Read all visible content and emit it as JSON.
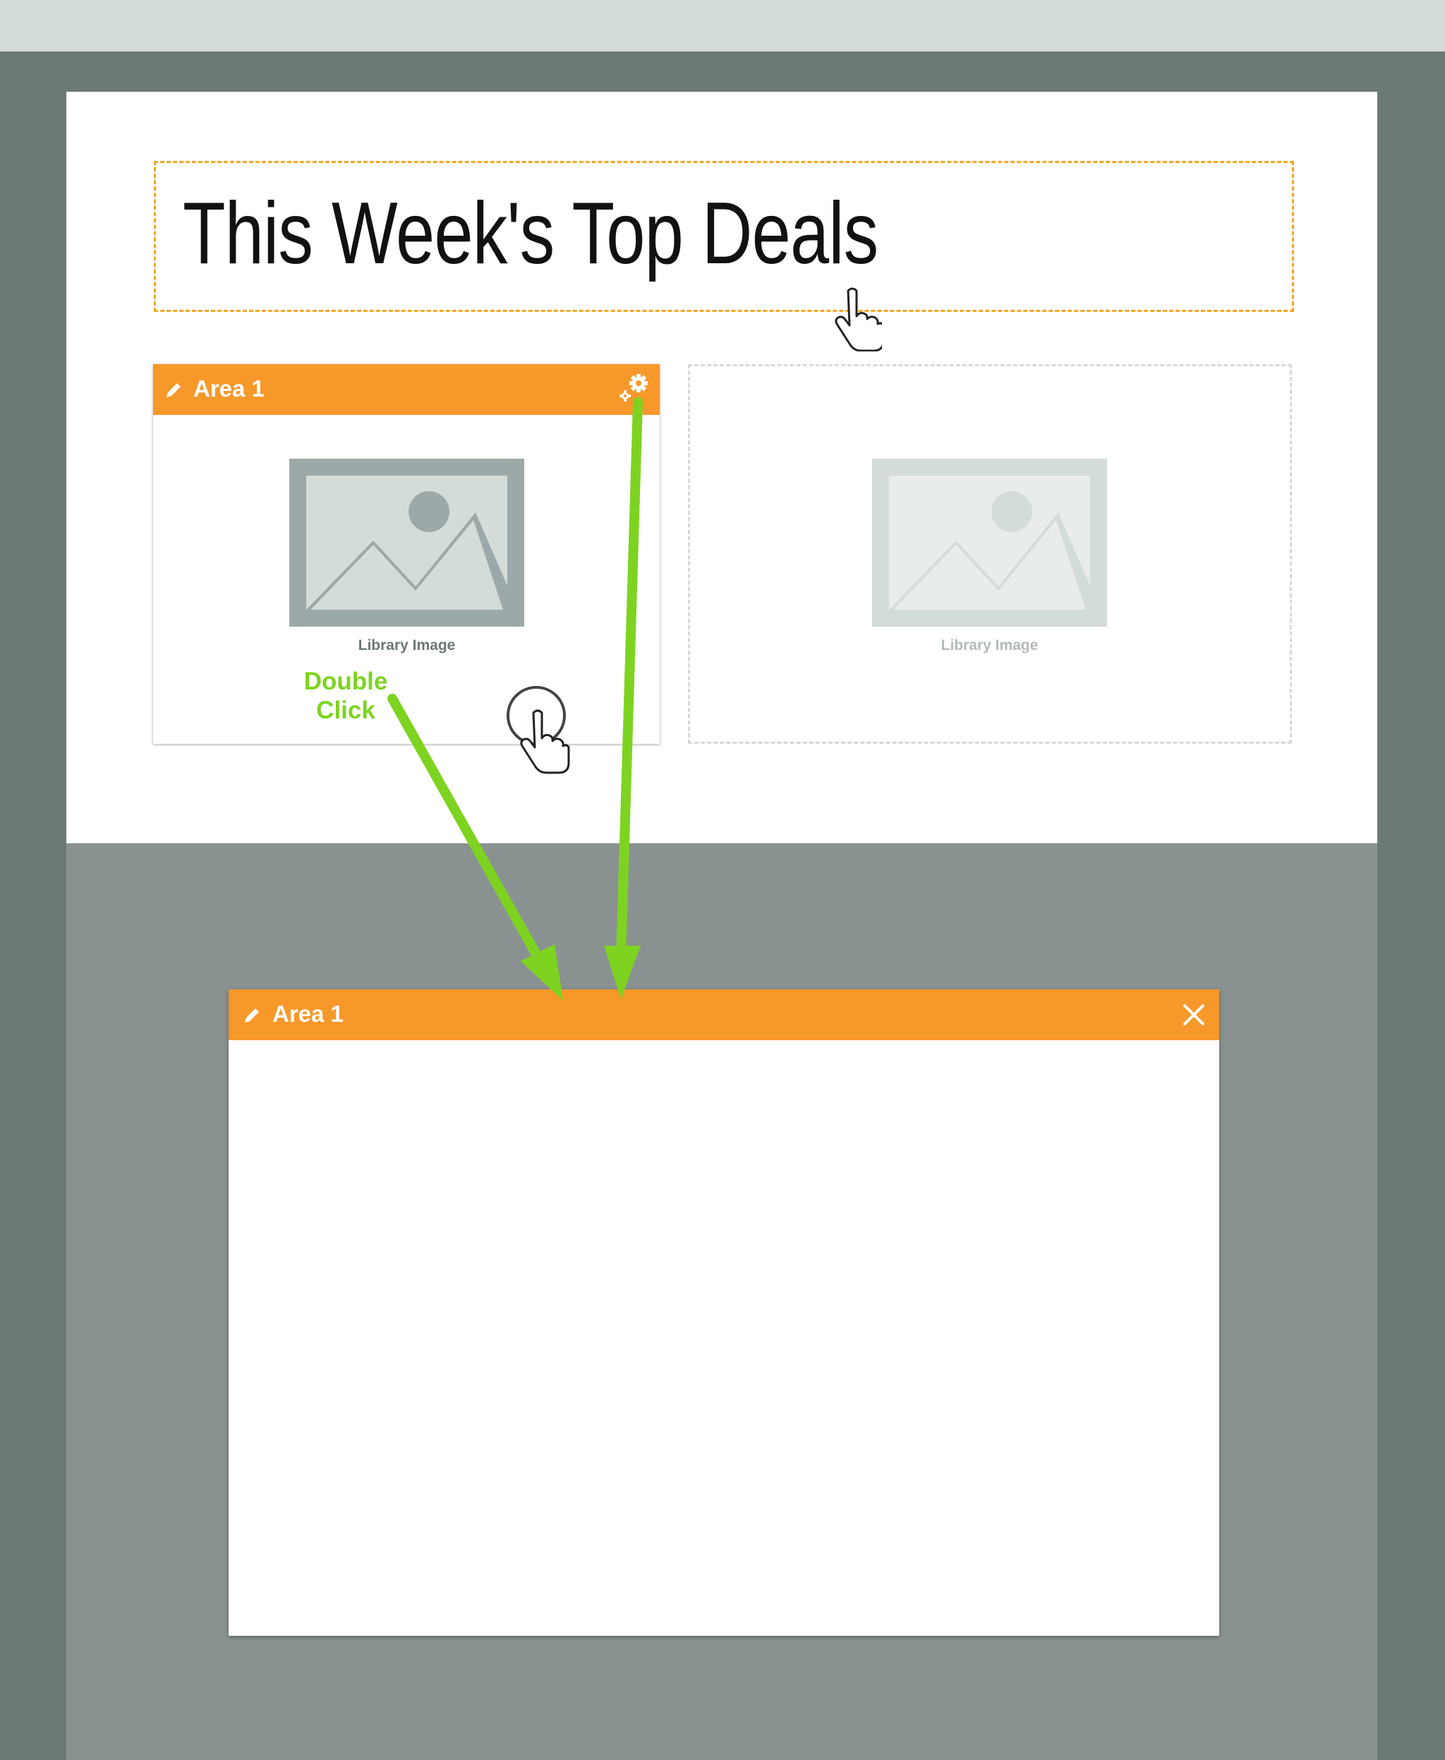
{
  "headline": {
    "text": "This Week's Top Deals"
  },
  "area_panel": {
    "title": "Area 1",
    "image_caption": "Library Image",
    "icons": {
      "edit": "pencil-icon",
      "settings": "gear-icon"
    }
  },
  "empty_slot": {
    "image_caption": "Library Image"
  },
  "annotation": {
    "text": "Double\nClick",
    "color": "#7ed321"
  },
  "dialog": {
    "title": "Area 1",
    "icons": {
      "edit": "pencil-icon",
      "close": "close-icon"
    }
  },
  "colors": {
    "accent": "#f7982a",
    "highlight_border": "#f5a623",
    "annotation_green": "#7ed321",
    "frame": "#6c7976",
    "overlay": "#8a9291"
  }
}
